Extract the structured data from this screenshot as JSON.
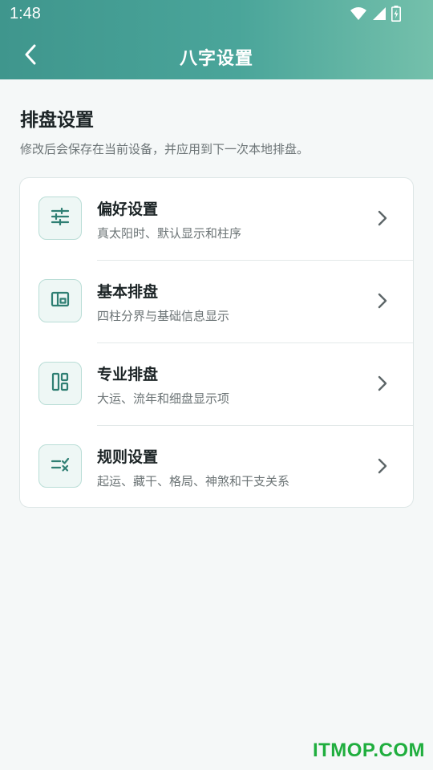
{
  "status_bar": {
    "time": "1:48",
    "icons": [
      "wifi-icon",
      "cellular-signal-icon",
      "battery-charging-icon"
    ]
  },
  "app_bar": {
    "back_icon": "chevron-left-icon",
    "title": "八字设置"
  },
  "section": {
    "title": "排盘设置",
    "description": "修改后会保存在当前设备，并应用到下一次本地排盘。"
  },
  "settings": {
    "items": [
      {
        "icon": "sliders-icon",
        "title": "偏好设置",
        "subtitle": "真太阳时、默认显示和柱序"
      },
      {
        "icon": "layout-icon",
        "title": "基本排盘",
        "subtitle": "四柱分界与基础信息显示"
      },
      {
        "icon": "dashboard-icon",
        "title": "专业排盘",
        "subtitle": "大运、流年和细盘显示项"
      },
      {
        "icon": "rules-check-icon",
        "title": "规则设置",
        "subtitle": "起运、藏干、格局、神煞和干支关系"
      }
    ]
  },
  "colors": {
    "accent": "#3f968d",
    "header_gradient_end": "#74c0ab",
    "background": "#f5f8f8",
    "icon_stroke": "#2f7f73"
  },
  "watermark": "ITMOP.COM"
}
